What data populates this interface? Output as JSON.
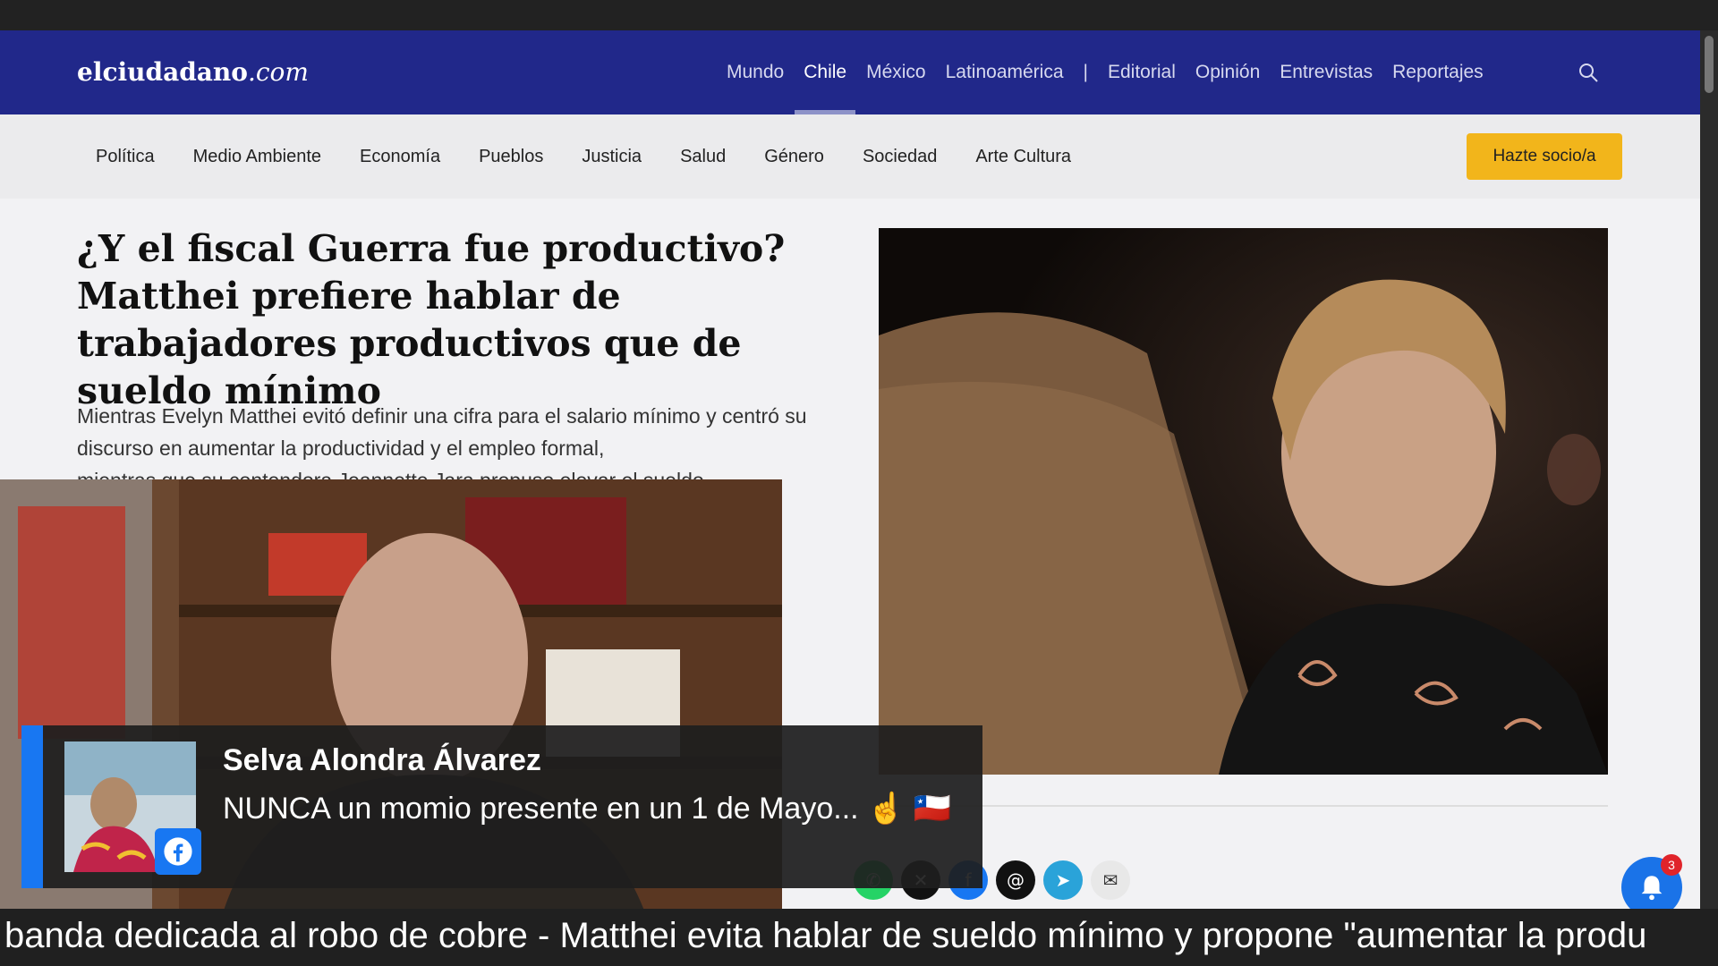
{
  "site": {
    "logo_bold": "elciudadano",
    "logo_italic": ".com"
  },
  "main_nav": {
    "items": [
      "Mundo",
      "Chile",
      "México",
      "Latinoamérica"
    ],
    "separator": "|",
    "items_after": [
      "Editorial",
      "Opinión",
      "Entrevistas",
      "Reportajes"
    ],
    "active": "Chile"
  },
  "sub_nav": {
    "items": [
      "Política",
      "Medio Ambiente",
      "Economía",
      "Pueblos",
      "Justicia",
      "Salud",
      "Género",
      "Sociedad",
      "Arte Cultura"
    ],
    "cta_label": "Hazte socio/a"
  },
  "article": {
    "headline": "¿Y el fiscal Guerra fue productivo? Matthei prefiere hablar de trabajadores productivos que de sueldo mínimo",
    "lede": "Mientras Evelyn Matthei evitó definir una cifra para el salario mínimo y centró su discurso en aumentar la productividad y el empleo formal,",
    "lede_partial": "mientras que su contendora Jeannette Jara propuso elevar el sueldo"
  },
  "notifications": {
    "count": "3"
  },
  "comment": {
    "name": "Selva Alondra Álvarez",
    "text": "NUNCA un momio presente en un 1 de Mayo... ☝ 🇨🇱"
  },
  "ticker": {
    "text": "banda dedicada al robo de cobre - Matthei evita hablar de sueldo mínimo y propone \"aumentar la produ"
  },
  "colors": {
    "header_bg": "#21288a",
    "cta_bg": "#f2b51b",
    "facebook_blue": "#1877f2",
    "badge_red": "#e0242a"
  },
  "share_icons": [
    "whatsapp-icon",
    "x-icon",
    "facebook-icon",
    "threads-icon",
    "telegram-icon",
    "email-icon"
  ]
}
